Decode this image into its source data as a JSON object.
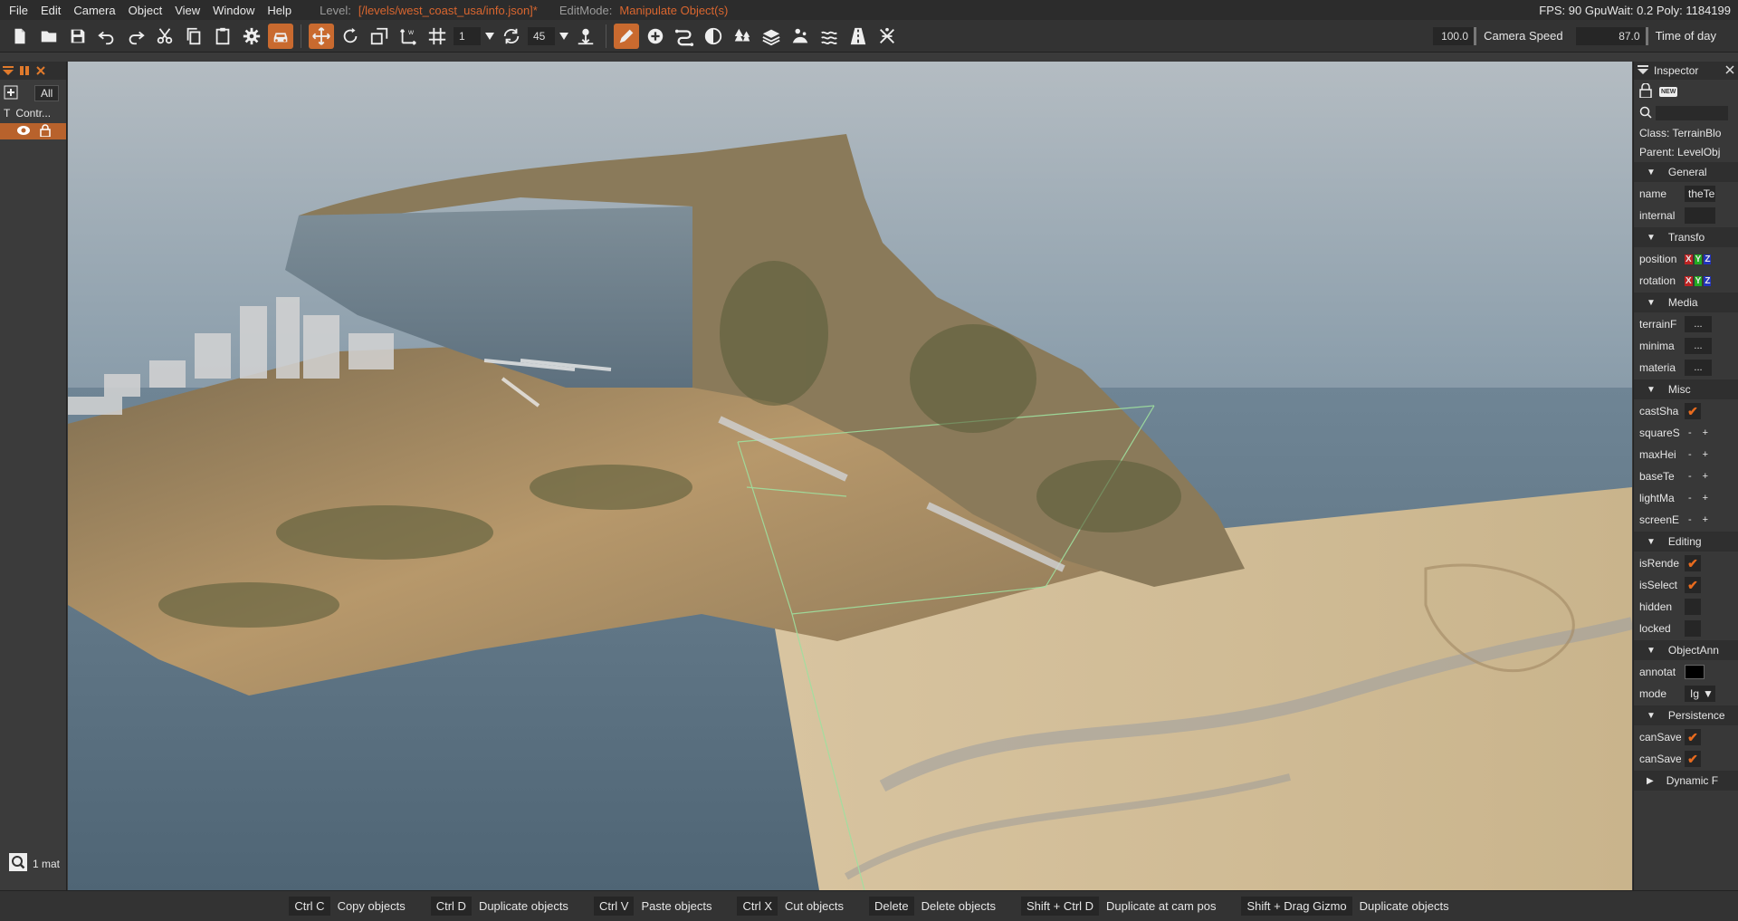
{
  "menu": {
    "items": [
      "File",
      "Edit",
      "Camera",
      "Object",
      "View",
      "Window",
      "Help"
    ],
    "level_label": "Level:",
    "level_value": "[/levels/west_coast_usa/info.json]*",
    "editmode_label": "EditMode:",
    "editmode_value": "Manipulate Object(s)",
    "stats": "FPS: 90  GpuWait: 0.2  Poly: 1184199"
  },
  "toolbar": {
    "snap_value": "1",
    "rotate_snap_value": "45",
    "camera_speed_value": "100.0",
    "camera_speed_label": "Camera Speed",
    "time_of_day_value": "87.0",
    "time_of_day_label": "Time of day",
    "accent": "#c96a2f"
  },
  "left_panel": {
    "filter_all": "All",
    "row_letter": "T",
    "row_label": "Contr...",
    "bottom_text": "1 mat"
  },
  "inspector": {
    "title": "Inspector",
    "badge": "NEW",
    "class_text": "Class:  TerrainBlo",
    "parent_text": "Parent:  LevelObj",
    "groups": {
      "general": "General",
      "transform": "Transfo",
      "media": "Media",
      "misc": "Misc",
      "editing": "Editing",
      "annotation": "ObjectAnn",
      "persistence": "Persistence",
      "dynamic": "Dynamic F"
    },
    "rows": {
      "name_label": "name",
      "name_value": "theTe",
      "internal_label": "internal",
      "position_label": "position",
      "rotation_label": "rotation",
      "terrainfile_label": "terrainF",
      "minimap_label": "minima",
      "material_label": "materia",
      "castshadows_label": "castSha",
      "squaresize_label": "squareS",
      "maxheight_label": "maxHei",
      "basetex_label": "baseTe",
      "lightmap_label": "lightMa",
      "screenerror_label": "screenE",
      "isrender_label": "isRende",
      "isselect_label": "isSelect",
      "hidden_label": "hidden",
      "locked_label": "locked",
      "annotation_label": "annotat",
      "mode_label": "mode",
      "mode_value": "Ig",
      "cansave1_label": "canSave",
      "cansave2_label": "canSave",
      "dots": "...",
      "minus": "-",
      "plus": "+",
      "x": "X",
      "y": "Y",
      "z": "Z"
    }
  },
  "statusbar": [
    {
      "key": "Ctrl C",
      "desc": "Copy objects"
    },
    {
      "key": "Ctrl D",
      "desc": "Duplicate objects"
    },
    {
      "key": "Ctrl V",
      "desc": "Paste objects"
    },
    {
      "key": "Ctrl X",
      "desc": "Cut objects"
    },
    {
      "key": "Delete",
      "desc": "Delete objects"
    },
    {
      "key": "Shift + Ctrl D",
      "desc": "Duplicate at cam pos"
    },
    {
      "key": "Shift + Drag Gizmo",
      "desc": "Duplicate objects"
    }
  ]
}
